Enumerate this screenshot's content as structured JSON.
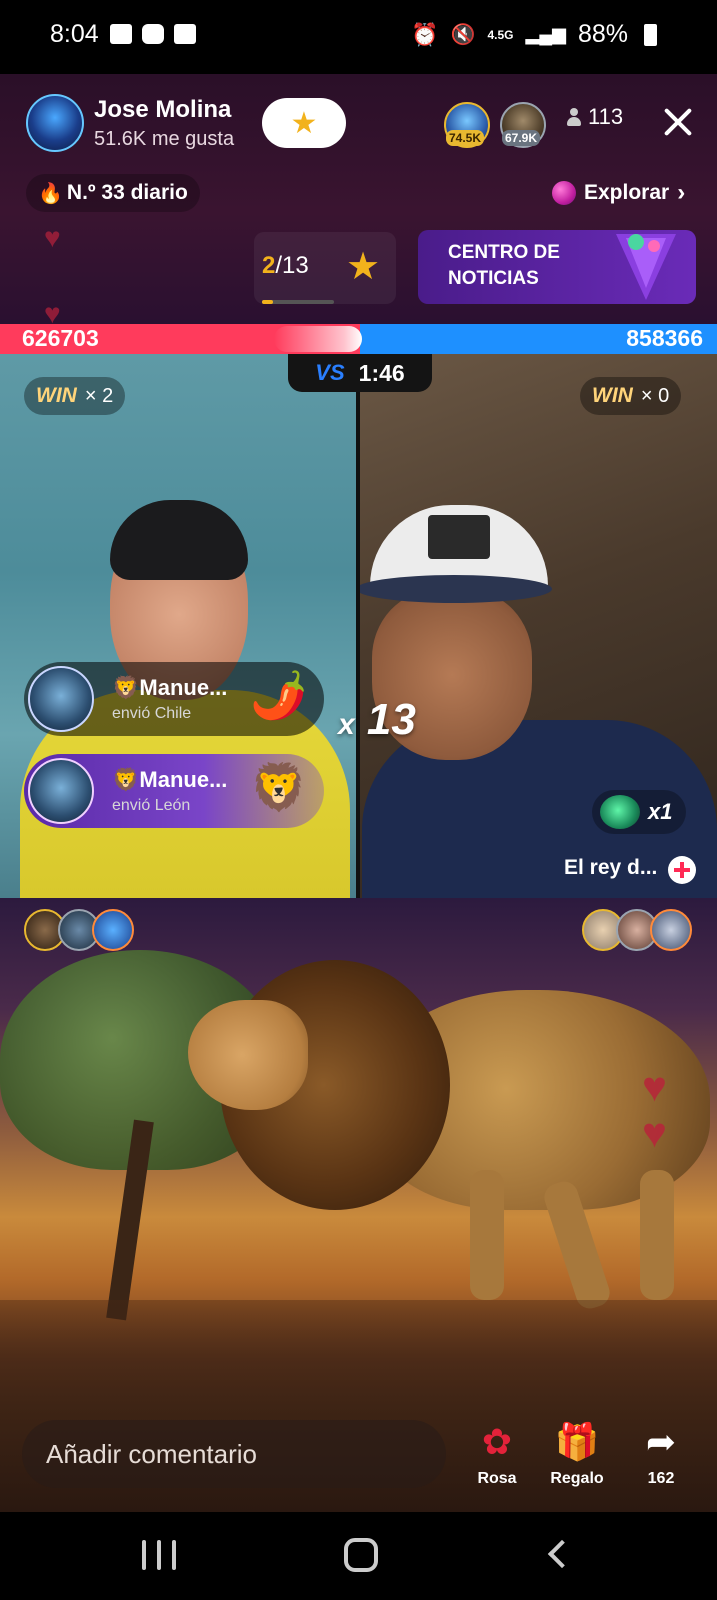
{
  "status_bar": {
    "time": "8:04",
    "network": "4.5G",
    "battery": "88%"
  },
  "host": {
    "name": "Jose Molina",
    "likes": "51.6K me gusta",
    "follow_icon": "star-icon"
  },
  "top_viewers": [
    {
      "badge": "74.5K"
    },
    {
      "badge": "67.9K"
    }
  ],
  "viewer_count": "113",
  "daily_rank": "N.º 33 diario",
  "explore_label": "Explorar",
  "challenge": {
    "current": "2",
    "total": "/13",
    "progress": 0.15
  },
  "news_banner": "CENTRO DE NOTICIAS",
  "battle": {
    "left_score": "626703",
    "right_score": "858366",
    "timer": "1:46",
    "vs_label": "VS",
    "left_win": {
      "label": "WIN",
      "count": "× 2"
    },
    "right_win": {
      "label": "WIN",
      "count": "× 0"
    }
  },
  "gifts": [
    {
      "sender": "🦁Manue...",
      "action": "envió Chile",
      "emoji": "🌶️"
    },
    {
      "sender": "🦁Manue...",
      "action": "envió León",
      "emoji": "🦁"
    }
  ],
  "combo": {
    "prefix": "x",
    "count": "13"
  },
  "opponent": {
    "mini_gift_count": "x1",
    "name": "El rey d..."
  },
  "bottom": {
    "comment_placeholder": "Añadir comentario",
    "rose_label": "Rosa",
    "gift_label": "Regalo",
    "share_count": "162"
  },
  "colors": {
    "left_team": "#ff3b5c",
    "right_team": "#1e90ff",
    "accent_gold": "#f2b21c"
  }
}
